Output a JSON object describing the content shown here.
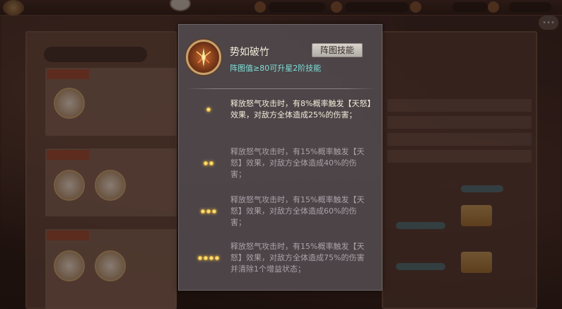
{
  "popup": {
    "skill_name": "势如破竹",
    "tag_label": "阵图技能",
    "subtitle": "阵图值≥80可升星2阶技能",
    "levels": [
      {
        "dots": 1,
        "active": true,
        "text": "释放怒气攻击时，有8%概率触发【天怒】效果，对敌方全体造成25%的伤害；"
      },
      {
        "dots": 2,
        "active": false,
        "text": "释放怒气攻击时，有15%概率触发【天怒】效果，对敌方全体造成40%的伤害；"
      },
      {
        "dots": 3,
        "active": false,
        "text": "释放怒气攻击时，有15%概率触发【天怒】效果，对敌方全体造成60%的伤害；"
      },
      {
        "dots": 4,
        "active": false,
        "text": "释放怒气攻击时，有15%概率触发【天怒】效果，对敌方全体造成75%的伤害并清除1个增益状态；"
      }
    ]
  },
  "colors": {
    "popup_bg": "#4e464a",
    "active_text": "#f2ead8",
    "inactive_text": "#a8a2a6",
    "subtitle": "#7ee0d8",
    "dot": "#f0c040"
  },
  "icons": {
    "skill_icon": "flaming-sword-icon",
    "chat_icon": "chat-bubble-icon"
  }
}
